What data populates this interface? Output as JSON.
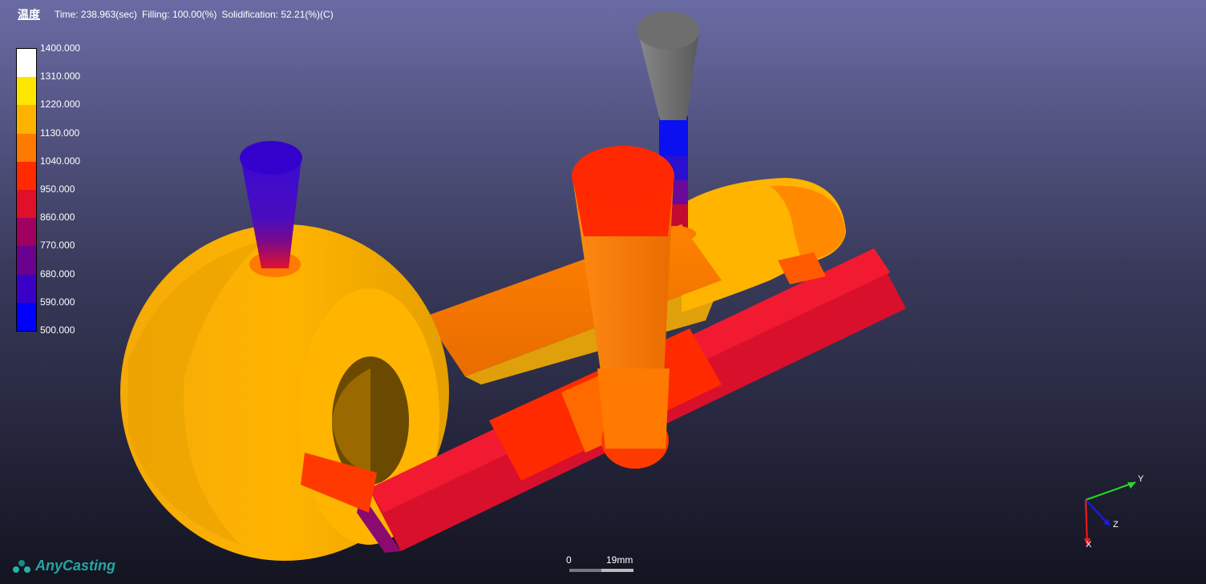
{
  "header": {
    "mode_label": "温度",
    "time_text": "Time: 238.963(sec)",
    "filling_text": "Filling: 100.00(%)",
    "solidification_text": "Solidification: 52.21(%)(C)"
  },
  "legend": {
    "labels": [
      "1400.000",
      "1310.000",
      "1220.000",
      "1130.000",
      "1040.000",
      "950.000",
      "860.000",
      "770.000",
      "680.000",
      "590.000",
      "500.000"
    ],
    "colors": [
      "#ffffff",
      "#ffe600",
      "#ffb300",
      "#ff7a00",
      "#ff2a00",
      "#e0102a",
      "#a00060",
      "#6a0090",
      "#3a00c8",
      "#0000ff"
    ]
  },
  "scale_bar": {
    "zero": "0",
    "length": "19mm"
  },
  "axes": {
    "x": "X",
    "y": "Y",
    "z": "Z"
  },
  "logo": {
    "text": "AnyCasting"
  }
}
